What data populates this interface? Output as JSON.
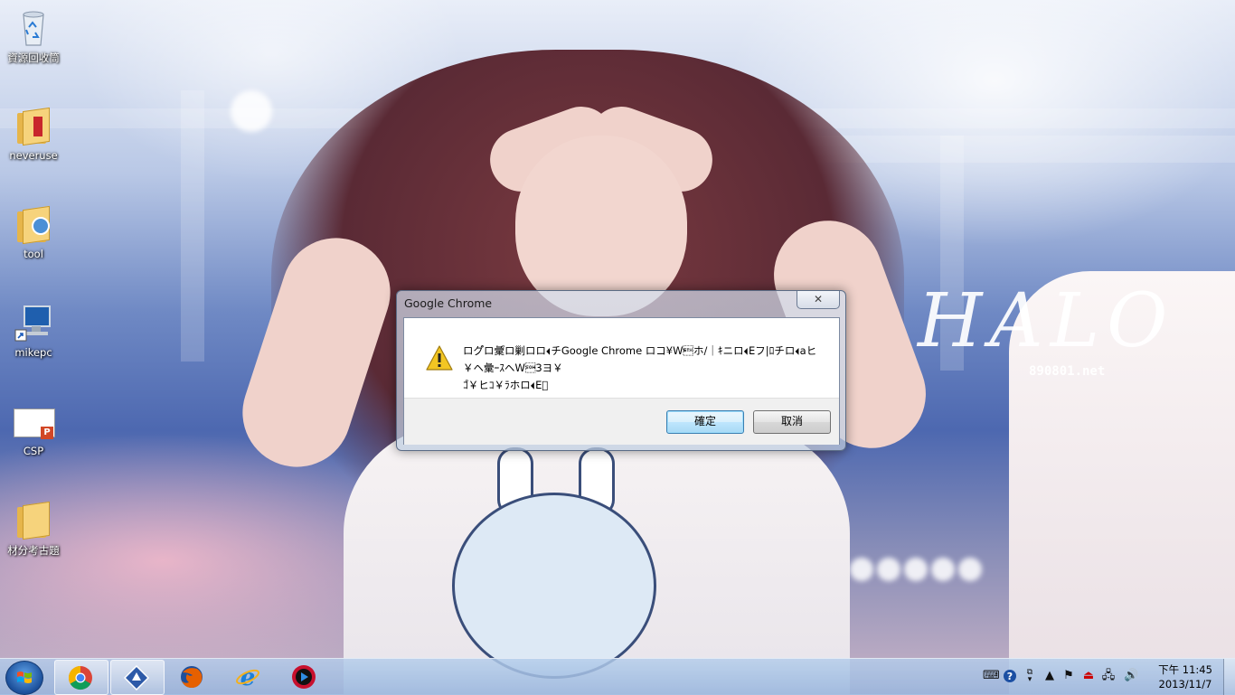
{
  "desktop": {
    "wallpaper_logo": "HALO",
    "wallpaper_url": "890801.net",
    "icons": [
      {
        "label": "資源回收筒",
        "icon": "recycle-bin-icon"
      },
      {
        "label": "neveruse",
        "icon": "folder-icon"
      },
      {
        "label": "tool",
        "icon": "folder-icon"
      },
      {
        "label": "mikepc",
        "icon": "computer-shortcut-icon"
      },
      {
        "label": "CSP",
        "icon": "powerpoint-file-icon"
      },
      {
        "label": "材分考古題",
        "icon": "folder-icon"
      }
    ]
  },
  "dialog": {
    "title": "Google Chrome",
    "close_glyph": "✕",
    "message_line1": "ログ゚ロ彙゚ロ剿ロロ\fチGoogle Chrome ロコ¥W\u0003ホ/｜ｷニロ\fEフ|ﾛチロ\faヒ￥ヘ彙ｰｽヘW\u00013ヨ￥",
    "message_line2": "ｺ゚￥ヒｺ￥ﾗホロ\fE゚",
    "ok_label": "確定",
    "cancel_label": "取消",
    "icon": "warning-icon"
  },
  "taskbar": {
    "start": "windows-start-icon",
    "buttons": [
      {
        "icon": "chrome-icon",
        "active": true
      },
      {
        "icon": "app-shortcut-icon",
        "active": true
      },
      {
        "icon": "firefox-icon",
        "active": false
      },
      {
        "icon": "internet-explorer-icon",
        "active": false
      },
      {
        "icon": "media-player-icon",
        "active": false
      }
    ],
    "tray": {
      "icons": [
        "keyboard-icon",
        "help-icon",
        "language-icon",
        "show-hidden-icons-icon",
        "action-center-flag-icon",
        "safely-remove-icon",
        "network-icon",
        "volume-icon"
      ]
    },
    "clock": {
      "time": "下午 11:45",
      "date": "2013/11/7"
    }
  }
}
